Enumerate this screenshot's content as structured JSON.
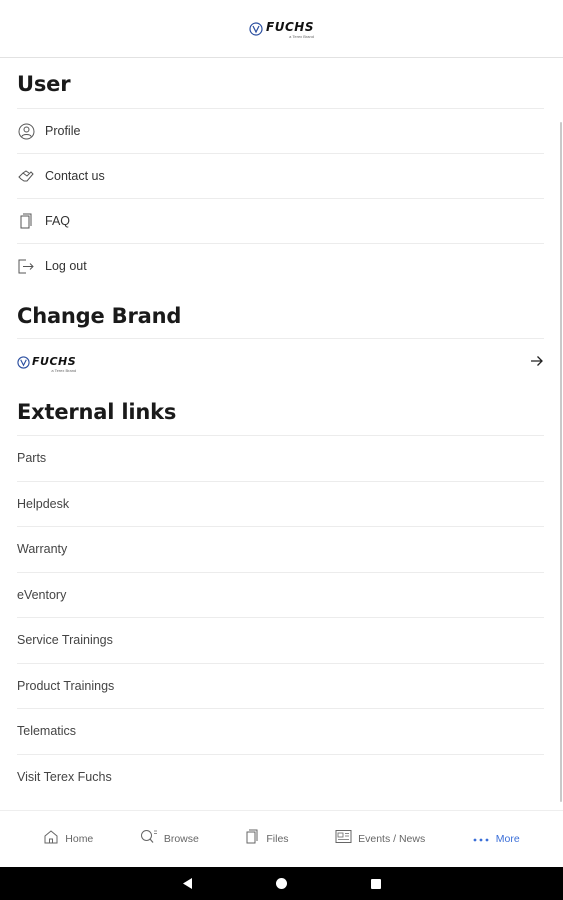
{
  "header": {
    "brand": "FUCHS",
    "brand_sub": "a Terex Brand"
  },
  "sections": {
    "user_title": "User",
    "brand_title": "Change Brand",
    "links_title": "External links"
  },
  "user_items": [
    {
      "label": "Profile",
      "icon": "person-circle-icon"
    },
    {
      "label": "Contact us",
      "icon": "handshake-icon"
    },
    {
      "label": "FAQ",
      "icon": "documents-icon"
    },
    {
      "label": "Log out",
      "icon": "logout-icon"
    }
  ],
  "brand_row": {
    "brand": "FUCHS",
    "brand_sub": "a Terex Brand",
    "icon": "arrow-right-icon"
  },
  "external_links": [
    "Parts",
    "Helpdesk",
    "Warranty",
    "eVentory",
    "Service Trainings",
    "Product Trainings",
    "Telematics",
    "Visit Terex Fuchs"
  ],
  "bottom_nav": [
    {
      "label": "Home",
      "icon": "home-icon"
    },
    {
      "label": "Browse",
      "icon": "search-icon"
    },
    {
      "label": "Files",
      "icon": "files-icon"
    },
    {
      "label": "Events / News",
      "icon": "news-icon"
    },
    {
      "label": "More",
      "icon": "more-dots-icon",
      "active": true
    }
  ],
  "colors": {
    "accent": "#3b6fd8",
    "divider": "#ececec",
    "text": "#333333"
  }
}
